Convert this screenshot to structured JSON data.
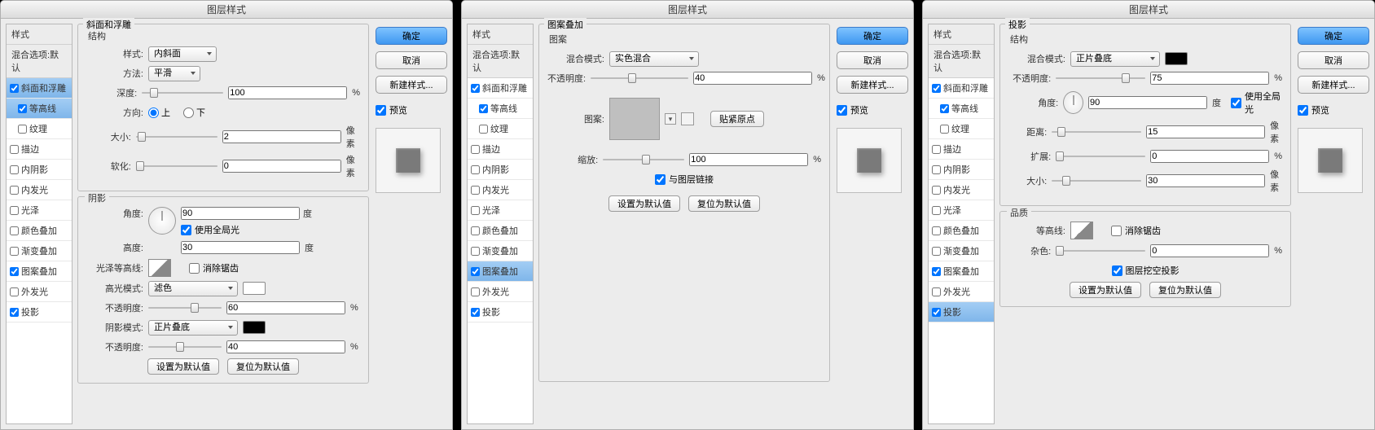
{
  "common": {
    "window_title": "图层样式",
    "sidebar_header": "样式",
    "sidebar_sub": "混合选项:默认",
    "buttons": {
      "ok": "确定",
      "cancel": "取消",
      "new_style": "新建样式...",
      "preview": "预览",
      "make_default": "设置为默认值",
      "reset_default": "复位为默认值"
    },
    "units": {
      "percent": "%",
      "px": "像素",
      "deg": "度"
    }
  },
  "styles_list": [
    {
      "key": "bevel",
      "label": "斜面和浮雕"
    },
    {
      "key": "contour",
      "label": "等高线",
      "indent": true
    },
    {
      "key": "texture",
      "label": "纹理",
      "indent": true
    },
    {
      "key": "stroke",
      "label": "描边"
    },
    {
      "key": "inner_shadow",
      "label": "内阴影"
    },
    {
      "key": "inner_glow",
      "label": "内发光"
    },
    {
      "key": "satin",
      "label": "光泽"
    },
    {
      "key": "color_overlay",
      "label": "颜色叠加"
    },
    {
      "key": "gradient_overlay",
      "label": "渐变叠加"
    },
    {
      "key": "pattern_overlay",
      "label": "图案叠加"
    },
    {
      "key": "outer_glow",
      "label": "外发光"
    },
    {
      "key": "drop_shadow",
      "label": "投影"
    }
  ],
  "panels": {
    "bevel": {
      "title": "斜面和浮雕",
      "struct_title": "结构",
      "labels": {
        "style": "样式:",
        "technique": "方法:",
        "depth": "深度:",
        "direction": "方向:",
        "up": "上",
        "down": "下",
        "size": "大小:",
        "soften": "软化:"
      },
      "values": {
        "style": "内斜面",
        "technique": "平滑",
        "depth": "100",
        "size": "2",
        "soften": "0"
      },
      "shade_title": "阴影",
      "shade_labels": {
        "angle": "角度:",
        "use_global": "使用全局光",
        "altitude": "高度:",
        "gloss_contour": "光泽等高线:",
        "anti_alias": "消除锯齿",
        "highlight_mode": "高光模式:",
        "opacity": "不透明度:",
        "shadow_mode": "阴影模式:"
      },
      "shade_values": {
        "angle": "90",
        "altitude": "30",
        "highlight_mode": "滤色",
        "highlight_opacity": "60",
        "shadow_mode": "正片叠底",
        "shadow_opacity": "40"
      }
    },
    "pattern": {
      "title": "图案叠加",
      "group": "图案",
      "labels": {
        "blend": "混合模式:",
        "opacity": "不透明度:",
        "pattern": "图案:",
        "snap": "贴紧原点",
        "scale": "缩放:",
        "link": "与图层链接"
      },
      "values": {
        "blend": "实色混合",
        "opacity": "40",
        "scale": "100"
      }
    },
    "shadow": {
      "title": "投影",
      "struct": "结构",
      "labels": {
        "blend": "混合模式:",
        "opacity": "不透明度:",
        "angle": "角度:",
        "use_global": "使用全局光",
        "distance": "距离:",
        "spread": "扩展:",
        "size": "大小:"
      },
      "values": {
        "blend": "正片叠底",
        "opacity": "75",
        "angle": "90",
        "distance": "15",
        "spread": "0",
        "size": "30"
      },
      "quality": "品质",
      "q_labels": {
        "contour": "等高线:",
        "anti_alias": "消除锯齿",
        "noise": "杂色:"
      },
      "q_values": {
        "noise": "0"
      },
      "knockout": "图层挖空投影"
    }
  },
  "windows": [
    {
      "active": "bevel",
      "checked": [
        "bevel",
        "contour",
        "pattern_overlay",
        "drop_shadow"
      ]
    },
    {
      "active": "pattern_overlay",
      "checked": [
        "bevel",
        "contour",
        "pattern_overlay",
        "drop_shadow"
      ]
    },
    {
      "active": "drop_shadow",
      "checked": [
        "bevel",
        "contour",
        "pattern_overlay",
        "drop_shadow"
      ]
    }
  ]
}
